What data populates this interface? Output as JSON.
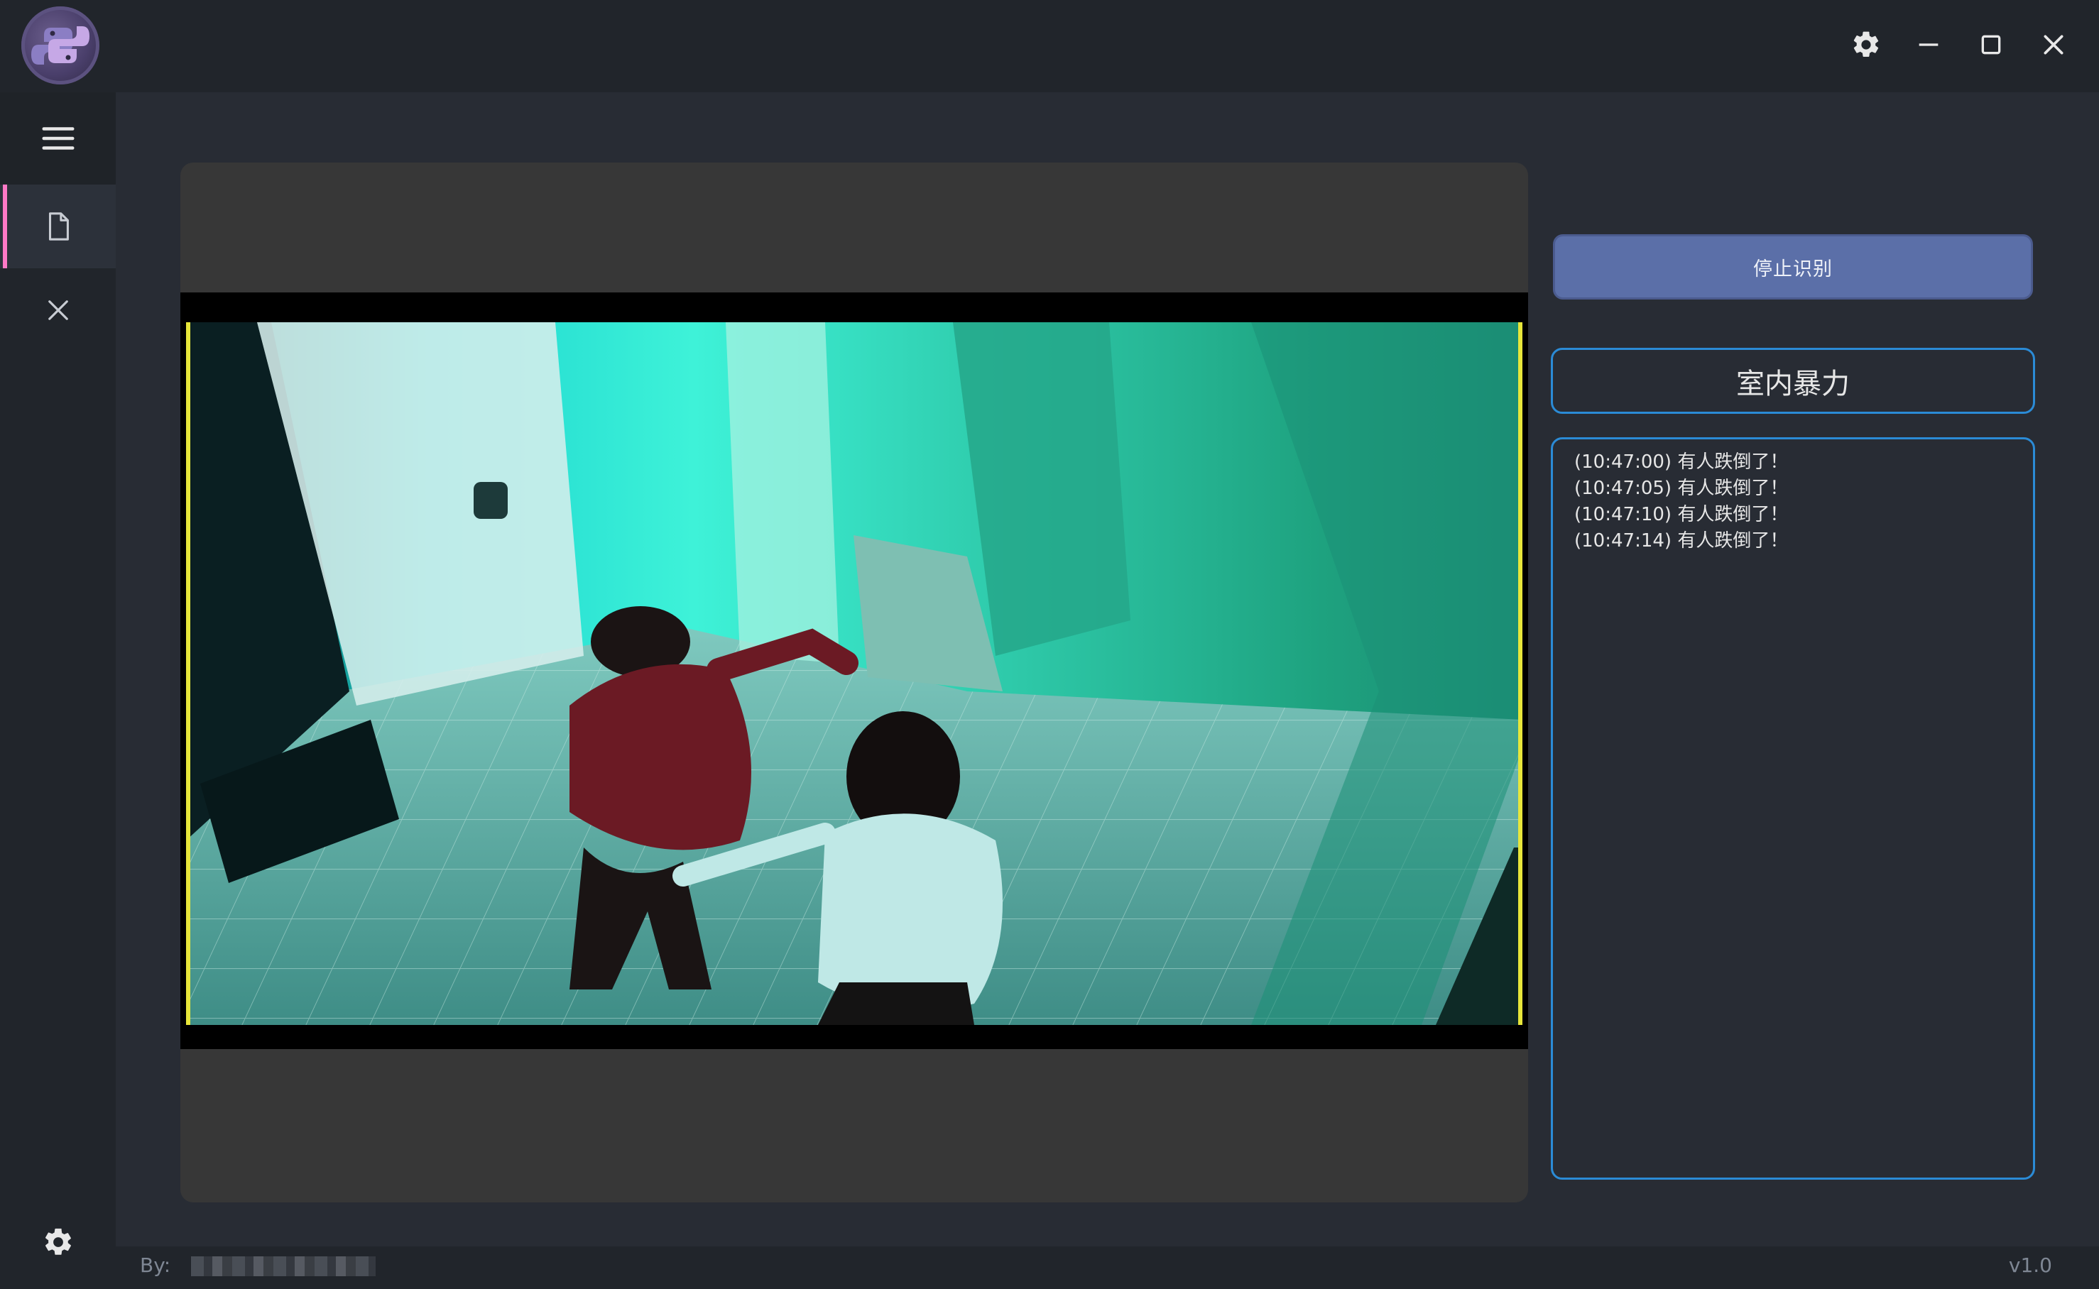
{
  "titlebar": {
    "logo_icon": "python-logo-icon",
    "controls": {
      "settings_icon": "gear-icon",
      "minimize_icon": "minimize-icon",
      "maximize_icon": "maximize-icon",
      "close_icon": "close-icon"
    }
  },
  "sidebar": {
    "items": [
      {
        "icon": "hamburger-menu-icon"
      },
      {
        "icon": "file-icon",
        "active": true
      },
      {
        "icon": "close-icon"
      }
    ],
    "bottom_icon": "gear-icon",
    "active_accent_color": "#ff79c6"
  },
  "video": {
    "content": "surveillance-video-frame"
  },
  "controls": {
    "stop_button_label": "停止识别",
    "detection_type": "室内暴力"
  },
  "log": {
    "entries": [
      "(10:47:00) 有人跌倒了！",
      "(10:47:05) 有人跌倒了！",
      "(10:47:10) 有人跌倒了！",
      "(10:47:14) 有人跌倒了！"
    ]
  },
  "footer": {
    "credit_label": "By:",
    "version": "v1.0"
  },
  "colors": {
    "background": "#282c34",
    "panel": "#21252b",
    "button_bg": "#5b6fa8",
    "border_accent": "#2b8bd6"
  }
}
